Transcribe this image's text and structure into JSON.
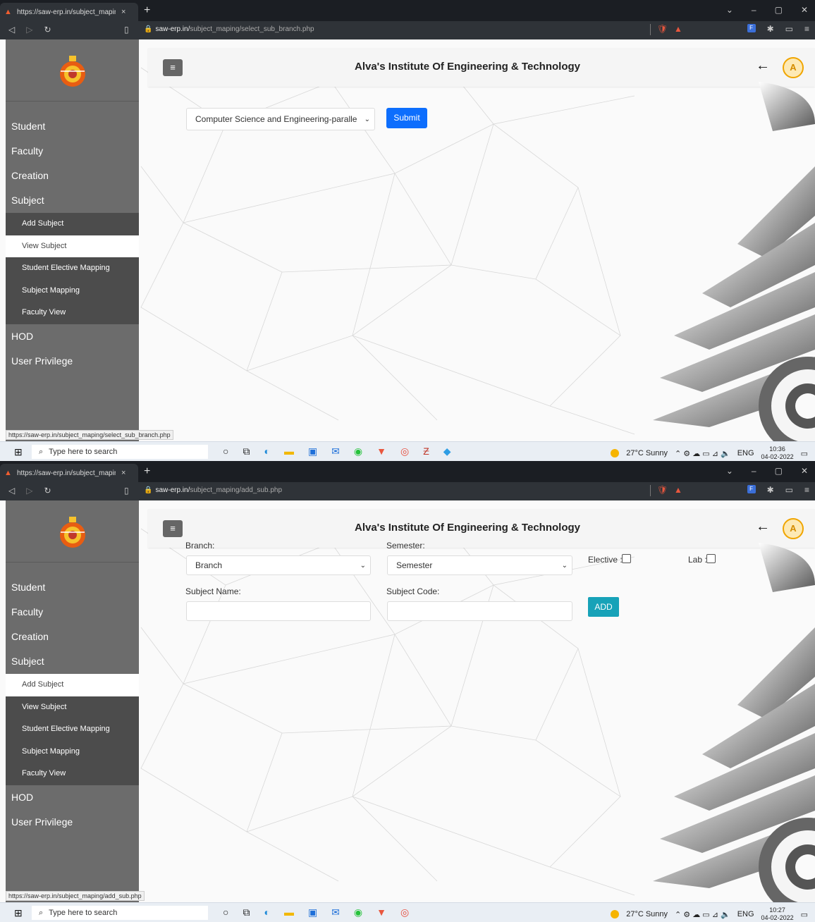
{
  "screens": [
    {
      "tab_title": "https://saw-erp.in/subject_mapin",
      "url_host": "saw-erp.in/",
      "url_path": "subject_maping/select_sub_branch.php",
      "status_url": "https://saw-erp.in/subject_maping/select_sub_branch.php",
      "clock_time": "10:36",
      "clock_date": "04-02-2022"
    },
    {
      "tab_title": "https://saw-erp.in/subject_mapin",
      "url_host": "saw-erp.in/",
      "url_path": "subject_maping/add_sub.php",
      "status_url": "https://saw-erp.in/subject_maping/add_sub.php",
      "clock_time": "10:27",
      "clock_date": "04-02-2022"
    }
  ],
  "header": {
    "title": "Alva's Institute Of Engineering & Technology",
    "avatar_letter": "A",
    "back_glyph": "←",
    "menu_glyph": "≡"
  },
  "sidebar": {
    "items": [
      "Student",
      "Faculty",
      "Creation",
      "Subject"
    ],
    "subitems": [
      "Add Subject",
      "View Subject",
      "Student Elective Mapping",
      "Subject Mapping",
      "Faculty View"
    ],
    "items_after": [
      "HOD",
      "User Privilege"
    ]
  },
  "screen1_form": {
    "branch_selected": "Computer Science and Engineering-paralle",
    "submit_label": "Submit"
  },
  "screen2_form": {
    "branch_label": "Branch:",
    "branch_selected": "Branch",
    "semester_label": "Semester:",
    "semester_selected": "Semester",
    "elective_label": "Elective :",
    "lab_label": "Lab :",
    "subject_name_label": "Subject Name:",
    "subject_code_label": "Subject Code:",
    "add_label": "ADD"
  },
  "taskbar": {
    "search_placeholder": "Type here to search",
    "weather": "27°C  Sunny",
    "lang": "ENG"
  },
  "icons": [
    "windows-icon",
    "search-icon",
    "cortana-icon",
    "task-view-icon",
    "edge-icon",
    "explorer-icon",
    "store-icon",
    "mail-icon",
    "whatsapp-icon",
    "brave-icon",
    "chrome-icon",
    "filezilla-icon",
    "app-icon"
  ]
}
